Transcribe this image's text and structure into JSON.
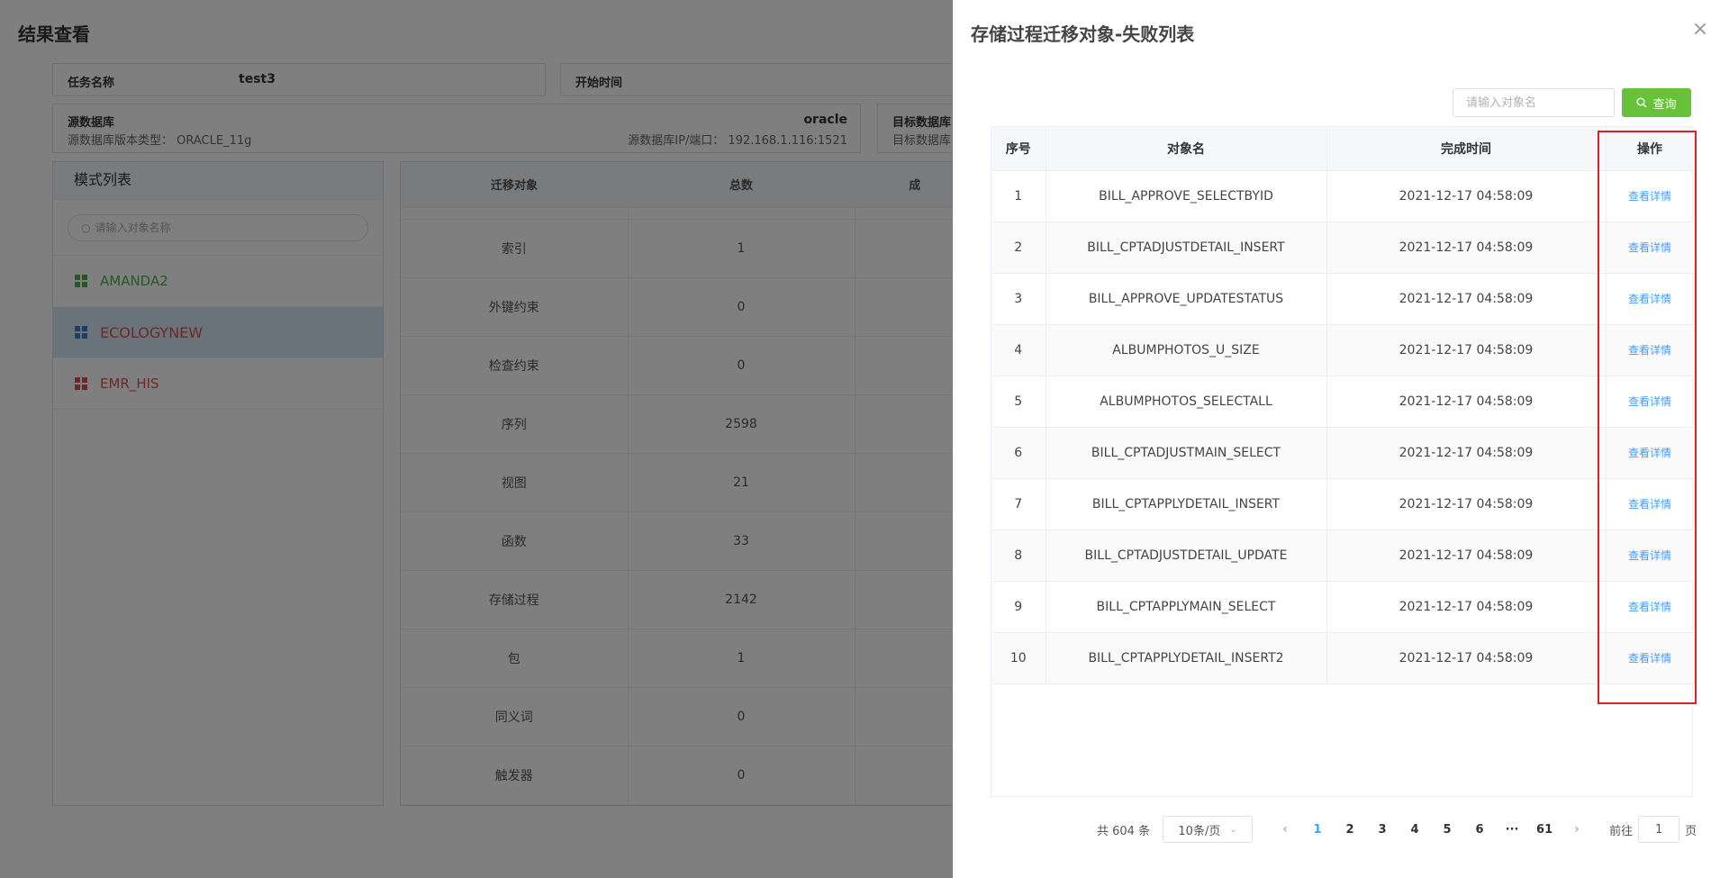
{
  "background": {
    "page_title": "结果查看",
    "task_name_label": "任务名称",
    "task_name_value": "test3",
    "start_time_label": "开始时间",
    "source_db_label": "源数据库",
    "source_db_type": "oracle",
    "source_db_version": "源数据库版本类型：  ORACLE_11g",
    "source_db_ip": "源数据库IP/端口：  192.168.1.116:1521",
    "target_db_label": "目标数据库",
    "target_db_sub": "目标数据库",
    "mode_panel": {
      "title": "模式列表",
      "search_placeholder": "请输入对象名称",
      "items": [
        {
          "label": "AMANDA2",
          "color": "#4caf50"
        },
        {
          "label": "ECOLOGYNEW",
          "color": "#d9534f"
        },
        {
          "label": "EMR_HIS",
          "color": "#d9534f"
        }
      ],
      "icon_colors": {
        "green": "#4caf50",
        "blue": "#3a7bd5",
        "red": "#d9534f"
      }
    },
    "object_table": {
      "columns": [
        "迁移对象",
        "总数",
        "成"
      ],
      "rows": [
        {
          "name": "索引",
          "total": "1"
        },
        {
          "name": "外键约束",
          "total": "0"
        },
        {
          "name": "检查约束",
          "total": "0"
        },
        {
          "name": "序列",
          "total": "2598"
        },
        {
          "name": "视图",
          "total": "21"
        },
        {
          "name": "函数",
          "total": "33"
        },
        {
          "name": "存储过程",
          "total": "2142"
        },
        {
          "name": "包",
          "total": "1"
        },
        {
          "name": "同义词",
          "total": "0"
        },
        {
          "name": "触发器",
          "total": "0"
        }
      ]
    }
  },
  "drawer": {
    "title": "存储过程迁移对象-失败列表",
    "close_icon": "×",
    "search_placeholder": "请输入对象名",
    "query_label": "查询",
    "columns": [
      "序号",
      "对象名",
      "完成时间",
      "操作"
    ],
    "rows": [
      {
        "no": "1",
        "name": "BILL_APPROVE_SELECTBYID",
        "time": "2021-12-17 04:58:09",
        "action": "查看详情"
      },
      {
        "no": "2",
        "name": "BILL_CPTADJUSTDETAIL_INSERT",
        "time": "2021-12-17 04:58:09",
        "action": "查看详情"
      },
      {
        "no": "3",
        "name": "BILL_APPROVE_UPDATESTATUS",
        "time": "2021-12-17 04:58:09",
        "action": "查看详情"
      },
      {
        "no": "4",
        "name": "ALBUMPHOTOS_U_SIZE",
        "time": "2021-12-17 04:58:09",
        "action": "查看详情"
      },
      {
        "no": "5",
        "name": "ALBUMPHOTOS_SELECTALL",
        "time": "2021-12-17 04:58:09",
        "action": "查看详情"
      },
      {
        "no": "6",
        "name": "BILL_CPTADJUSTMAIN_SELECT",
        "time": "2021-12-17 04:58:09",
        "action": "查看详情"
      },
      {
        "no": "7",
        "name": "BILL_CPTAPPLYDETAIL_INSERT",
        "time": "2021-12-17 04:58:09",
        "action": "查看详情"
      },
      {
        "no": "8",
        "name": "BILL_CPTADJUSTDETAIL_UPDATE",
        "time": "2021-12-17 04:58:09",
        "action": "查看详情"
      },
      {
        "no": "9",
        "name": "BILL_CPTAPPLYMAIN_SELECT",
        "time": "2021-12-17 04:58:09",
        "action": "查看详情"
      },
      {
        "no": "10",
        "name": "BILL_CPTAPPLYDETAIL_INSERT2",
        "time": "2021-12-17 04:58:09",
        "action": "查看详情"
      }
    ],
    "pagination": {
      "total": "共 604 条",
      "page_size": "10条/页",
      "pages": [
        "1",
        "2",
        "3",
        "4",
        "5",
        "6",
        "61"
      ],
      "ellipsis": "···",
      "current": "1",
      "goto_label": "前往",
      "goto_value": "1",
      "page_suffix": "页"
    },
    "highlight_color": "#e0201e",
    "accent_color": "#409eff",
    "query_color": "#67c23a"
  }
}
